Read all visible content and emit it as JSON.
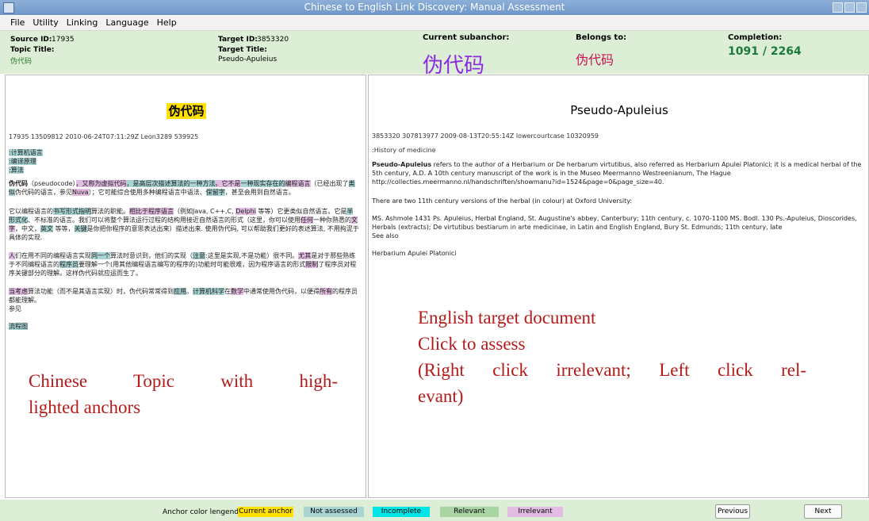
{
  "window": {
    "title": "Chinese to English Link Discovery: Manual Assessment"
  },
  "menu": [
    "File",
    "Utility",
    "Linking",
    "Language",
    "Help"
  ],
  "info": {
    "source_id_label": "Source ID:",
    "source_id": "17935",
    "topic_title_label": "Topic Title:",
    "topic_title": "伪代码",
    "target_id_label": "Target ID:",
    "target_id": "3853320",
    "target_title_label": "Target Title:",
    "target_title": "Pseudo-Apuleius",
    "current_subanchor_label": "Current subanchor:",
    "current_subanchor": "伪代码",
    "belongs_to_label": "Belongs to:",
    "belongs_to": "伪代码",
    "completion_label": "Completion:",
    "completion": "1091 / 2264"
  },
  "left_pane": {
    "title": "伪代码",
    "meta": "17935 13509812 2010-06-24T07:11:29Z Leon3289 539925",
    "categories": [
      ":计算机语言",
      ":编译原理",
      ":算法"
    ],
    "para1": [
      {
        "t": "伪代码",
        "s": "b"
      },
      {
        "t": "（pseudocode）"
      },
      {
        "t": "，又称为",
        "s": "ir"
      },
      {
        "t": "虚拟代码",
        "s": "ir"
      },
      {
        "t": "，是高层次描述算法的",
        "s": "na"
      },
      {
        "t": "一种方法",
        "s": "na"
      },
      {
        "t": "。它不是",
        "s": "ir"
      },
      {
        "t": "一种现实存在的",
        "s": "na"
      },
      {
        "t": "编程语言",
        "s": "ir"
      },
      {
        "t": "（已经出现了"
      },
      {
        "t": "类似",
        "s": "na"
      },
      {
        "t": "伪代码的语言，参见"
      },
      {
        "t": "Nuva",
        "s": "ir"
      },
      {
        "t": "）；它可能综合使用多种编程语言中语法、"
      },
      {
        "t": "保留字",
        "s": "na"
      },
      {
        "t": "，甚至会用到自然语言。"
      }
    ],
    "para2": [
      {
        "t": "它以编程语言的"
      },
      {
        "t": "书写形式指明",
        "s": "na"
      },
      {
        "t": "算法的职能。"
      },
      {
        "t": "相比于程序语言",
        "s": "ir"
      },
      {
        "t": "（例如Java, C++,C, "
      },
      {
        "t": "Delphi",
        "s": "ir"
      },
      {
        "t": " 等等）它更类似自然语言。它是"
      },
      {
        "t": "半形式化",
        "s": "na"
      },
      {
        "t": "、不标准的语言。我们可以将整个算法运行过程的结构用接近自然语言的形式（这里，你可以使用"
      },
      {
        "t": "任何",
        "s": "ir"
      },
      {
        "t": "一种你熟悉的"
      },
      {
        "t": "文字",
        "s": "ir"
      },
      {
        "t": "，中文，"
      },
      {
        "t": "英文",
        "s": "na"
      },
      {
        "t": " 等等，"
      },
      {
        "t": "关键",
        "s": "na"
      },
      {
        "t": "是你把你程序的意思表达出来）描述出来. 使用伪代码, 可以帮助我们更好的表述算法, 不用拘泥于具体的实现."
      }
    ],
    "para3": [
      {
        "t": "人",
        "s": "ir"
      },
      {
        "t": "们在用不同的编程语言实现"
      },
      {
        "t": "同一个",
        "s": "na"
      },
      {
        "t": "算法时意识到，他们的实现（"
      },
      {
        "t": "注意",
        "s": "na"
      },
      {
        "t": ":这里是实现,不是功能）很不同。"
      },
      {
        "t": "尤其",
        "s": "ir"
      },
      {
        "t": "是对于那些熟练于不同编程语言的"
      },
      {
        "t": "程序员",
        "s": "na"
      },
      {
        "t": "要理解一个(用其他编程语言编写的程序的)功能时可能很难，因为程序语言的形式"
      },
      {
        "t": "限制",
        "s": "ir"
      },
      {
        "t": "了程序员对程序关键部分的理解。这样伪代码就应运而生了。"
      }
    ],
    "para4": [
      {
        "t": "当考虑",
        "s": "ir"
      },
      {
        "t": "算法功能（而不是其语言实现）时，伪代码常常得到"
      },
      {
        "t": "应用",
        "s": "na"
      },
      {
        "t": "。"
      },
      {
        "t": "计算机科学",
        "s": "na"
      },
      {
        "t": "在"
      },
      {
        "t": "数学",
        "s": "ir"
      },
      {
        "t": "中通常使用伪代码，以便得"
      },
      {
        "t": "所有",
        "s": "ir"
      },
      {
        "t": "的程序员都能理解。"
      }
    ],
    "see_also": "参见",
    "link": "流程图"
  },
  "right_pane": {
    "title": "Pseudo-Apuleius",
    "meta": "3853320 307813977 2009-08-13T20:55:14Z lowercourtcase 10320959",
    "category": ":History of medicine",
    "lead_bold": "Pseudo-Apuleius",
    "para1": " refers to the author of a Herbarium or De herbarum virtutibus, also referred as Herbarium Apulei Platonici; it is a medical herbal of the 5th century, A.D. A 10th century manuscript of the work is in the Museo Meermanno Westreenianum, The Hague http://collecties.meermanno.nl/handschriften/showmanu?id=1524&page=0&page_size=40.",
    "para2": "There are two 11th century versions of the herbal (in colour) at Oxford University:",
    "para3": "MS. Ashmole 1431 Ps. Apuleius, Herbal England, St. Augustine's abbey, Canterbury; 11th century, c. 1070-1100 MS. Bodl. 130 Ps.-Apuleius, Dioscorides, Herbals (extracts); De virtutibus bestiarum in arte medicinae, in Latin and English England, Bury St. Edmunds; 11th century, late",
    "see_also": "See also",
    "para4": "Herbarium Apulei Platonici"
  },
  "annotations": {
    "left": [
      "Chinese Topic with high-",
      "lighted anchors"
    ],
    "right": [
      "English target document",
      "Click to assess",
      "(Right click irrelevant; Left click rel-",
      "evant)"
    ]
  },
  "legend": {
    "label": "Anchor color lengend:",
    "items": [
      {
        "label": "Current anchor",
        "color": "#ffe000"
      },
      {
        "label": "Not assessed",
        "color": "#a8d4d4"
      },
      {
        "label": "Incomplete",
        "color": "#00e5e5"
      },
      {
        "label": "Relevant",
        "color": "#a9d4a4"
      },
      {
        "label": "Irrelevant",
        "color": "#e2bce2"
      }
    ]
  },
  "buttons": {
    "previous": "Previous",
    "next": "Next"
  },
  "colors": {
    "info_bg": "#dcefd6",
    "subanchor": "#8a2be2",
    "belongs": "#cc1155",
    "completion": "#1d7a3a",
    "annotation": "#b51a1a"
  }
}
